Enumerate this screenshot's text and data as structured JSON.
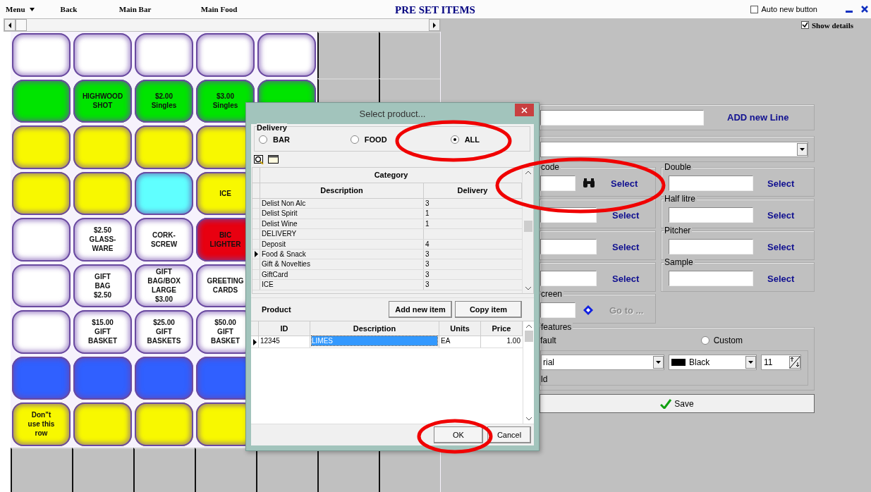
{
  "toolbar": {
    "menu": "Menu",
    "items": [
      "Back",
      "Main Bar",
      "Main Food"
    ],
    "title": "PRE SET ITEMS",
    "auto_new_button": {
      "label": "Auto new button",
      "checked": false
    },
    "show_details": {
      "label": "Show details",
      "checked": true
    }
  },
  "grid": {
    "rows": [
      {
        "cells": [
          {
            "color": "#ffffff"
          },
          {
            "color": "#ffffff"
          },
          {
            "color": "#ffffff"
          },
          {
            "color": "#ffffff"
          },
          {
            "color": "#ffffff"
          }
        ]
      },
      {
        "cells": [
          {
            "color": "#00e400"
          },
          {
            "label": "HIGHWOOD\nSHOT",
            "color": "#00e400"
          },
          {
            "label": "$2.00\nSingles",
            "color": "#00e400"
          },
          {
            "label": "$3.00\nSingles",
            "color": "#00e400"
          },
          {
            "color": "#00e400"
          }
        ]
      },
      {
        "cells": [
          {
            "color": "#f8f800"
          },
          {
            "color": "#f8f800"
          },
          {
            "color": "#f8f800"
          },
          {
            "color": "#f8f800"
          }
        ]
      },
      {
        "cells": [
          {
            "color": "#f8f800"
          },
          {
            "color": "#f8f800"
          },
          {
            "color": "#60ffff"
          },
          {
            "label": "ICE",
            "color": "#f8f800"
          }
        ]
      },
      {
        "cells": [
          {
            "color": "#ffffff"
          },
          {
            "label": "$2.50\nGLASS-\nWARE",
            "color": "#ffffff"
          },
          {
            "label": "CORK-\nSCREW",
            "color": "#ffffff"
          },
          {
            "label": "BIC\nLIGHTER",
            "color": "#e80010"
          }
        ]
      },
      {
        "cells": [
          {
            "color": "#ffffff"
          },
          {
            "label": "GIFT\nBAG\n$2.50",
            "color": "#ffffff"
          },
          {
            "label": "GIFT\nBAG/BOX\nLARGE\n$3.00",
            "color": "#ffffff"
          },
          {
            "label": "GREETING\nCARDS",
            "color": "#ffffff"
          }
        ]
      },
      {
        "cells": [
          {
            "color": "#ffffff"
          },
          {
            "label": "$15.00\nGIFT\nBASKET",
            "color": "#ffffff"
          },
          {
            "label": "$25.00\nGIFT\nBASKETS",
            "color": "#ffffff"
          },
          {
            "label": "$50.00\nGIFT\nBASKET",
            "color": "#ffffff"
          }
        ]
      },
      {
        "cells": [
          {
            "color": "#3060ff"
          },
          {
            "color": "#3060ff"
          },
          {
            "color": "#3060ff"
          },
          {
            "color": "#3060ff"
          }
        ]
      },
      {
        "cells": [
          {
            "label": "Don\"t\nuse this\nrow",
            "color": "#f8f800"
          },
          {
            "color": "#f8f800"
          },
          {
            "color": "#f8f800"
          },
          {
            "color": "#f8f800"
          }
        ]
      }
    ]
  },
  "dialog": {
    "title": "Select product...",
    "delivery": {
      "label": "Delivery",
      "options": [
        {
          "label": "BAR",
          "selected": false
        },
        {
          "label": "FOOD",
          "selected": false
        },
        {
          "label": "ALL",
          "selected": true
        }
      ]
    },
    "category_table": {
      "group_header": "Category",
      "columns": [
        "Description",
        "Delivery"
      ],
      "rows": [
        {
          "description": "Delist Non Alc",
          "delivery": "3",
          "selected": false
        },
        {
          "description": "Delist Spirit",
          "delivery": "1",
          "selected": false
        },
        {
          "description": "Delist Wine",
          "delivery": "1",
          "selected": false
        },
        {
          "description": "DELIVERY",
          "selected": false
        },
        {
          "description": "Deposit",
          "delivery": "4",
          "selected": false
        },
        {
          "description": "Food & Snack",
          "delivery": "3",
          "selected": true
        },
        {
          "description": "Gift & Novelties",
          "delivery": "3",
          "selected": false
        },
        {
          "description": "GiftCard",
          "delivery": "3",
          "selected": false
        },
        {
          "description": "ICE",
          "delivery": "3",
          "selected": false
        }
      ]
    },
    "product": {
      "label": "Product",
      "buttons": [
        "Add new item",
        "Copy item"
      ],
      "columns": [
        "ID",
        "Description",
        "Units",
        "Price"
      ],
      "rows": [
        {
          "id": "12345",
          "description": "LIMES",
          "units": "EA",
          "price": "1.00",
          "selected": true
        }
      ]
    },
    "buttons": [
      "OK",
      "Cancel"
    ]
  },
  "details": {
    "add_new_line": "ADD new Line",
    "barcode_label": "code",
    "left_selects": [
      "Select",
      "Select",
      "Select",
      "Select"
    ],
    "right_groups": [
      {
        "label": "Double",
        "link": "Select"
      },
      {
        "label": "Half litre",
        "link": "Select"
      },
      {
        "label": "Pitcher",
        "link": "Select"
      },
      {
        "label": "Sample",
        "link": "Select"
      }
    ],
    "screen": {
      "label": "creen",
      "link": "Go to ...",
      "disabled": true
    },
    "features": {
      "label": "features",
      "default_label": "fault",
      "custom": {
        "label": "Custom",
        "selected": false
      },
      "font": "rial",
      "color_name": "Black",
      "size": "11",
      "bold_label": "ld"
    },
    "save": "Save"
  }
}
